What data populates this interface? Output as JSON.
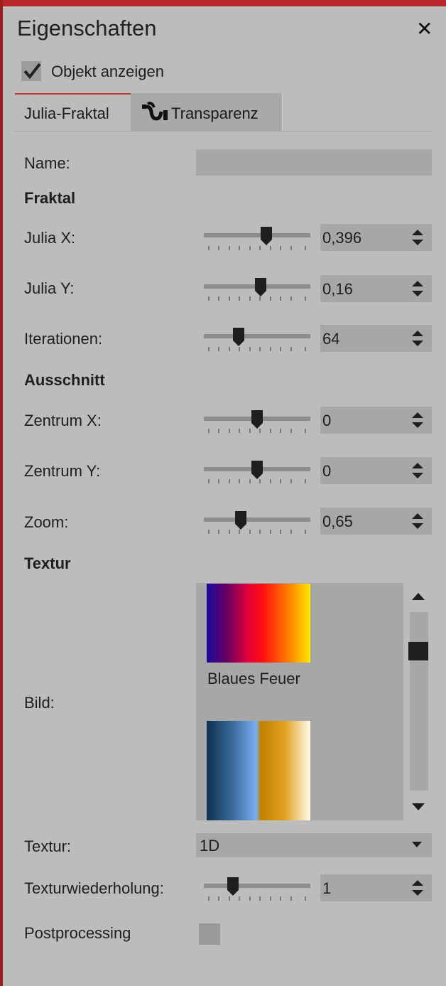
{
  "header": {
    "title": "Eigenschaften",
    "close_glyph": "✕",
    "show_object_label": "Objekt anzeigen",
    "show_object_checked": true
  },
  "tabs": [
    {
      "label": "Julia-Fraktal",
      "active": true
    },
    {
      "label": "Transparenz",
      "active": false,
      "icon": "wave-icon"
    }
  ],
  "name_label": "Name:",
  "name_value": "",
  "sections": {
    "fraktal": "Fraktal",
    "ausschnitt": "Ausschnitt",
    "textur": "Textur"
  },
  "fields": {
    "julia_x": {
      "label": "Julia X:",
      "value": "0,396"
    },
    "julia_y": {
      "label": "Julia Y:",
      "value": "0,16"
    },
    "iterationen": {
      "label": "Iterationen:",
      "value": "64"
    },
    "zentrum_x": {
      "label": "Zentrum X:",
      "value": "0"
    },
    "zentrum_y": {
      "label": "Zentrum Y:",
      "value": "0"
    },
    "zoom": {
      "label": "Zoom:",
      "value": "0,65"
    },
    "texturwiederholung": {
      "label": "Texturwiederholung:",
      "value": "1"
    }
  },
  "bild": {
    "label": "Bild:",
    "items": [
      {
        "name": "Blaues Feuer"
      },
      {
        "name": ""
      }
    ]
  },
  "textur_mode": {
    "label": "Textur:",
    "value": "1D"
  },
  "postprocessing": {
    "label": "Postprocessing",
    "checked": false
  },
  "colors": {
    "accent": "#b8282a",
    "panel_bg": "#bcbcbc",
    "control_bg": "#a7a7a7"
  }
}
